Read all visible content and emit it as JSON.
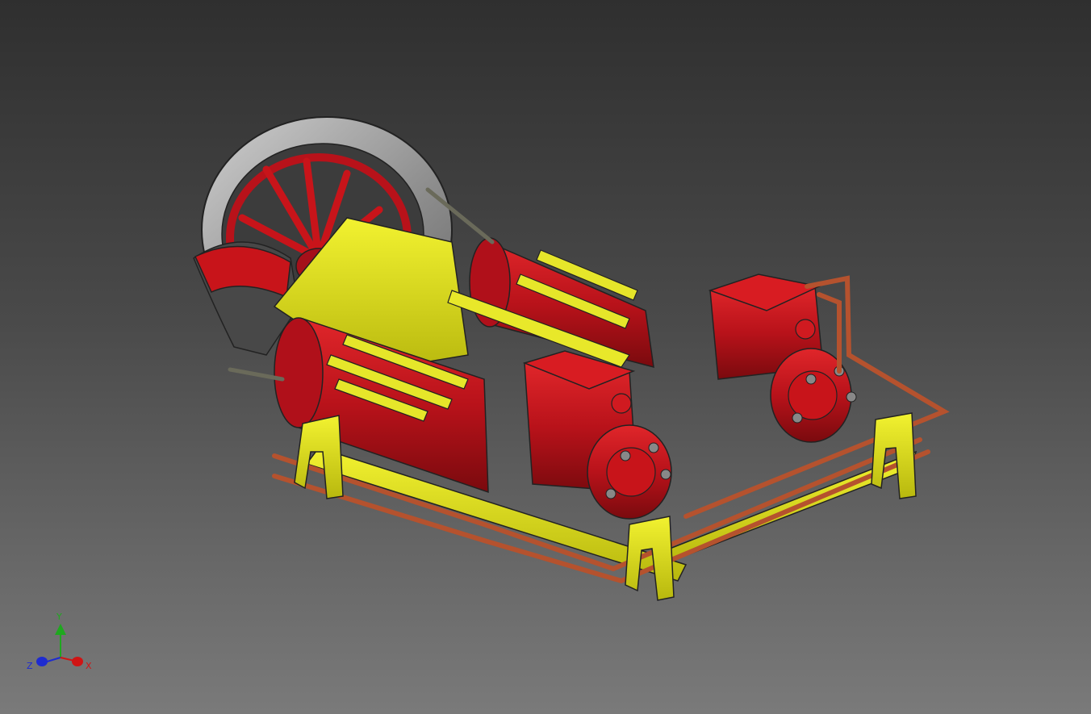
{
  "viewport": {
    "background_top": "#2f2f2f",
    "background_bottom": "#7a7a7a"
  },
  "model": {
    "colors": {
      "cylinder_red": "#c8141a",
      "frame_yellow": "#dada16",
      "pipe_copper": "#b5522e",
      "flywheel_rim": "#9a9a9a",
      "eccentric_dark": "#4a4a4a",
      "brass": "#9a6a2a"
    }
  },
  "triad": {
    "y_label": "Y",
    "z_label": "Z",
    "x_label": "X",
    "y_color": "#1fa81f",
    "z_color": "#1e2bd0",
    "x_color": "#d01414"
  }
}
